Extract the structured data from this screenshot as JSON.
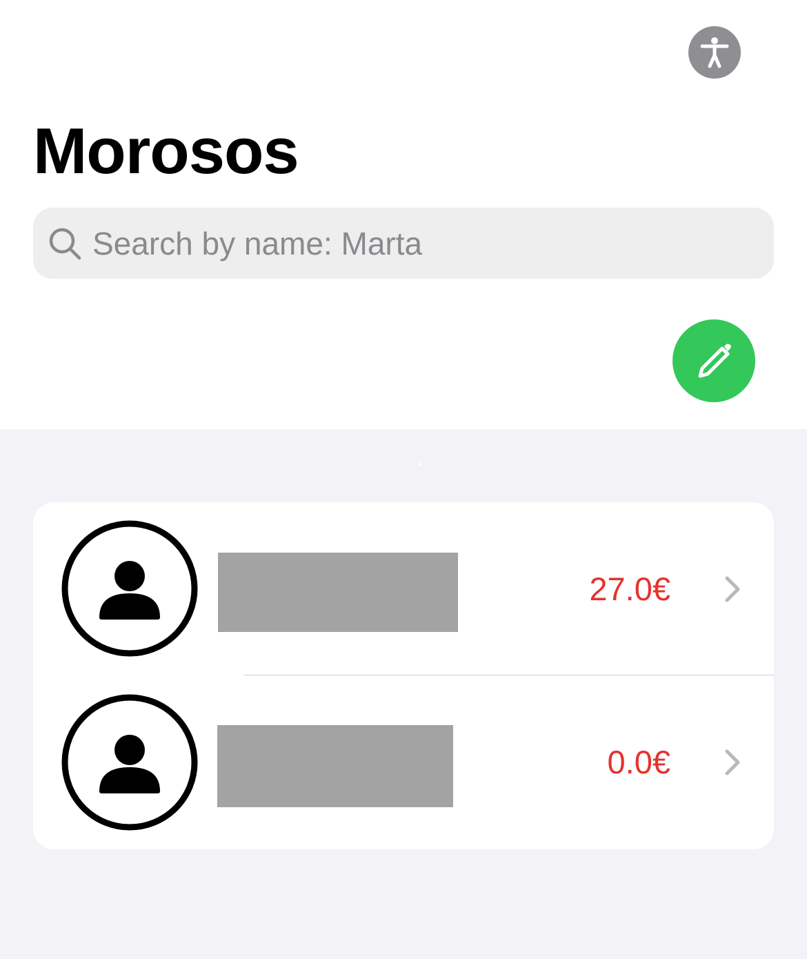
{
  "header": {
    "title": "Morosos",
    "accessibility_icon": "accessibility-icon"
  },
  "search": {
    "placeholder": "Search by name: Marta",
    "value": "",
    "icon": "search-icon"
  },
  "actions": {
    "edit_icon": "pencil-icon"
  },
  "debtors": [
    {
      "name": "[redacted]",
      "amount": "27.0€",
      "avatar_icon": "person-circle-icon",
      "chevron_icon": "chevron-right-icon"
    },
    {
      "name": "[redacted]",
      "amount": "0.0€",
      "avatar_icon": "person-circle-icon",
      "chevron_icon": "chevron-right-icon"
    }
  ],
  "colors": {
    "accent_green": "#34c759",
    "amount_red": "#e5322d",
    "background": "#f2f2f7",
    "redaction": "#a3a3a3"
  }
}
